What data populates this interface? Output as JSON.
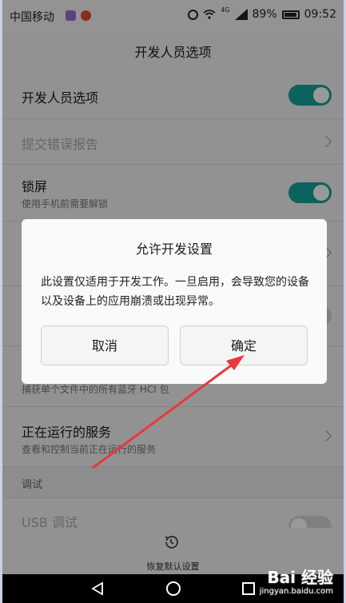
{
  "status_bar": {
    "carrier": "中国移动",
    "network": "4G",
    "battery": "89%",
    "time": "09:52"
  },
  "header": {
    "title": "开发人员选项"
  },
  "rows": [
    {
      "title": "开发人员选项",
      "toggle": "on"
    },
    {
      "title": "提交错误报告",
      "chevron": true
    },
    {
      "title": "锁屏",
      "subtitle": "使用手机前需要解锁",
      "toggle": "on"
    },
    {
      "subtitle": "捕获单个文件中的所有蓝牙 HCI 包"
    },
    {
      "title": "正在运行的服务",
      "subtitle": "查看和控制当前正在运行的服务",
      "chevron": true
    }
  ],
  "section": {
    "label": "调试"
  },
  "usb_row": {
    "title": "USB 调试",
    "toggle": "off"
  },
  "bottom_action": {
    "label": "恢复默认设置",
    "icon": "history-icon"
  },
  "dialog": {
    "title": "允许开发设置",
    "message": "此设置仅适用于开发工作。一旦启用，会导致您的设备以及设备上的应用崩溃或出现异常。",
    "cancel_label": "取消",
    "ok_label": "确定"
  },
  "annotation": {
    "color": "#e8393a"
  },
  "watermark": {
    "logo": "Bai 经验",
    "url": "jingyan.baidu.com"
  },
  "colors": {
    "toggle_on": "#14a49a",
    "overlay": "rgba(0,0,0,0.40)"
  }
}
